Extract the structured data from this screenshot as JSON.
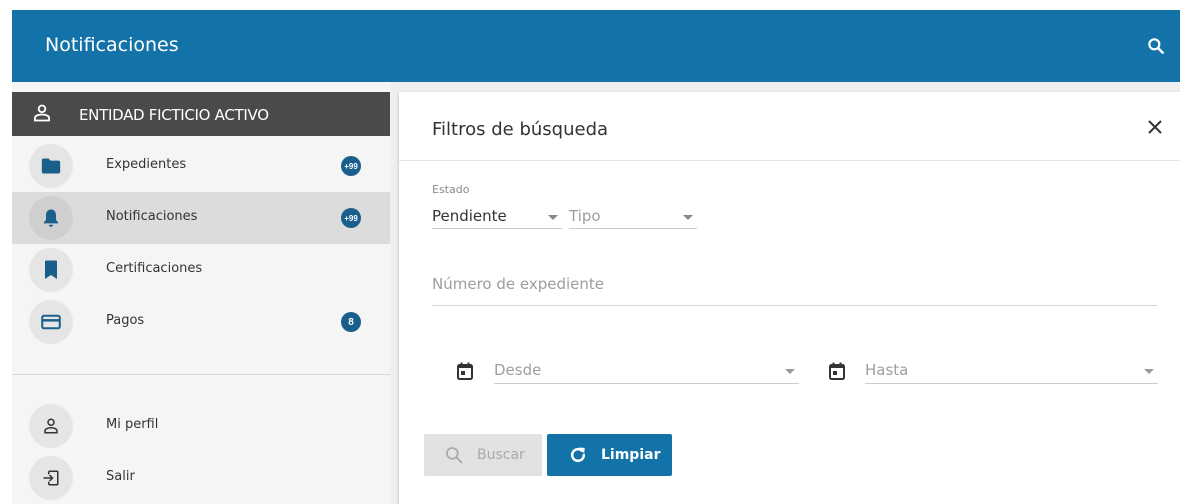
{
  "topbar": {
    "title": "Notificaciones",
    "search_icon": "search-icon"
  },
  "sidebar": {
    "entity_label": "ENTIDAD FICTICIO ACTIVO",
    "items": [
      {
        "label": "Expedientes",
        "icon": "folder-icon",
        "badge": "+99",
        "active": false
      },
      {
        "label": "Notificaciones",
        "icon": "bell-icon",
        "badge": "+99",
        "active": true
      },
      {
        "label": "Certificaciones",
        "icon": "bookmark-icon",
        "badge": "",
        "active": false
      },
      {
        "label": "Pagos",
        "icon": "credit-card-icon",
        "badge": "8",
        "active": false
      }
    ],
    "bottom_items": [
      {
        "label": "Mi perfil",
        "icon": "person-icon"
      },
      {
        "label": "Salir",
        "icon": "logout-icon"
      }
    ]
  },
  "filters": {
    "title": "Filtros de búsqueda",
    "estado_label": "Estado",
    "estado_value": "Pendiente",
    "tipo_placeholder": "Tipo",
    "expediente_placeholder": "Número de expediente",
    "desde_placeholder": "Desde",
    "hasta_placeholder": "Hasta",
    "buscar_label": "Buscar",
    "limpiar_label": "Limpiar"
  },
  "colors": {
    "primary": "#1373a9",
    "badge": "#1a5f8c",
    "entity_bar": "#4a4a4a",
    "active_item": "#dcdcdc"
  }
}
